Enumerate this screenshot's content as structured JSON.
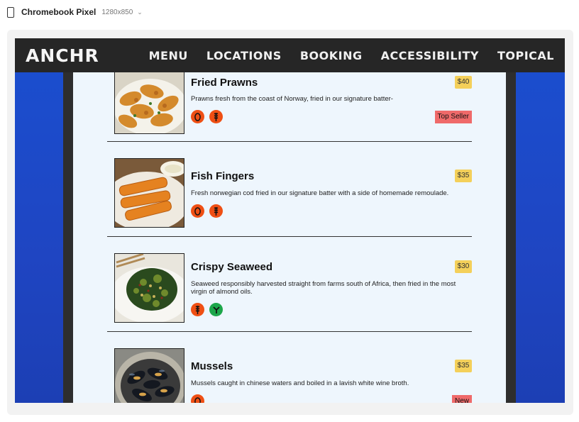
{
  "device": {
    "name": "Chromebook Pixel",
    "size": "1280x850",
    "caret": "⌄"
  },
  "site": {
    "brand": "ANCHR",
    "nav": [
      {
        "label": "MENU"
      },
      {
        "label": "LOCATIONS"
      },
      {
        "label": "BOOKING"
      },
      {
        "label": "ACCESSIBILITY"
      },
      {
        "label": "TOPICAL"
      }
    ]
  },
  "menu": {
    "items": [
      {
        "title": "Fried Prawns",
        "price": "$40",
        "description": "Prawns fresh from the coast of Norway, fried in our signature batter-",
        "icons": [
          "egg-icon",
          "wheat-icon"
        ],
        "tag": "Top Seller"
      },
      {
        "title": "Fish Fingers",
        "price": "$35",
        "description": "Fresh norwegian cod fried in our signature batter with a side of homemade remoulade.",
        "icons": [
          "egg-icon",
          "wheat-icon"
        ],
        "tag": ""
      },
      {
        "title": "Crispy Seaweed",
        "price": "$30",
        "description": "Seaweed responsibly harvested straight from farms south of Africa, then fried in the most virgin of almond oils.",
        "icons": [
          "wheat-icon",
          "vegan-icon"
        ],
        "tag": ""
      },
      {
        "title": "Mussels",
        "price": "$35",
        "description": "Mussels caught in chinese waters and boiled in a lavish white wine broth.",
        "icons": [
          "egg-icon"
        ],
        "tag": "New"
      }
    ]
  },
  "colors": {
    "navbar": "#262626",
    "background_blue": "#1a4fd0",
    "price_badge": "#f4d05a",
    "tag_badge": "#ef6a6a",
    "allergen_orange": "#ef4f14",
    "vegan_green": "#1ca64a"
  }
}
